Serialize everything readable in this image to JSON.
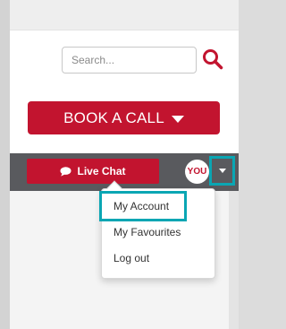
{
  "search": {
    "placeholder": "Search...",
    "icon": "search-icon"
  },
  "book_call": {
    "label": "BOOK A CALL",
    "icon": "caret-down-icon"
  },
  "user_bar": {
    "live_chat_label": "Live Chat",
    "live_chat_icon": "chat-bubble-icon",
    "avatar_text": "YOU",
    "menu_toggle_icon": "caret-down-icon"
  },
  "user_menu": {
    "items": [
      {
        "label": "My Account",
        "highlighted": true
      },
      {
        "label": "My Favourites"
      },
      {
        "label": "Log out"
      }
    ]
  },
  "colors": {
    "brand_red": "#c2142f",
    "bar_gray": "#595a5e",
    "highlight_teal": "#0aa6b3"
  }
}
